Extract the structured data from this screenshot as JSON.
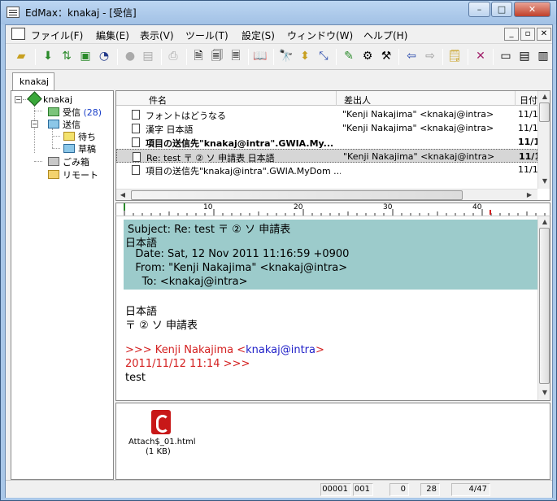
{
  "window": {
    "title": "EdMax：knakaj - [受信]",
    "min": "–",
    "max": "□",
    "close": "✕"
  },
  "menu": {
    "items": [
      "ファイル(F)",
      "編集(E)",
      "表示(V)",
      "ツール(T)",
      "設定(S)",
      "ウィンドウ(W)",
      "ヘルプ(H)"
    ],
    "mdi": [
      "_",
      "▫",
      "✕"
    ]
  },
  "tab": {
    "label": "knakaj"
  },
  "tree": {
    "root": "knakaj",
    "inbox": "受信",
    "inbox_count": "(28)",
    "sent": "送信",
    "waiting": "待ち",
    "draft": "草稿",
    "trash": "ごみ箱",
    "remote": "リモート"
  },
  "list": {
    "headers": {
      "subject": "件名",
      "from": "差出人",
      "date": "日付"
    },
    "rows": [
      {
        "subject": "フォントはどうなる",
        "from": "\"Kenji Nakajima\" <knakaj@intra>",
        "date": "11/1"
      },
      {
        "subject": "漢字 日本語",
        "from": "\"Kenji Nakajima\" <knakaj@intra>",
        "date": "11/1"
      },
      {
        "subject": "項目の送信先\"knakaj@intra\".GWIA.My...",
        "from": "",
        "date": "11/1"
      },
      {
        "subject": "Re: test 〒 ② ソ 申請表 日本語",
        "from": "\"Kenji Nakajima\" <knakaj@intra>",
        "date": "11/1"
      },
      {
        "subject": "項目の送信先\"knakaj@intra\".GWIA.MyDom ...",
        "from": "",
        "date": "11/1"
      }
    ]
  },
  "ruler": {
    "labels": [
      "10",
      "20",
      "30",
      "40"
    ]
  },
  "message": {
    "hdr_subject": "Subject: Re: test 〒 ② ソ 申請表",
    "hdr_subject2": "日本語",
    "hdr_date": "   Date: Sat, 12 Nov 2011 11:16:59 +0900",
    "hdr_from": "   From: \"Kenji Nakajima\" <knakaj@intra>",
    "hdr_to": "     To: <knakaj@intra>",
    "body1": "日本語",
    "body2": "〒 ② ソ 申請表",
    "quote_prefix": ">>> Kenji Nakajima <",
    "quote_email": "knakaj@intra",
    "quote_suffix": ">",
    "quote_date": "2011/11/12 11:14 >>>",
    "body3": "test"
  },
  "attachment": {
    "name": "Attach$_01.html",
    "size": "(1 KB)"
  },
  "status": {
    "a": "00001",
    "b": "001",
    "c": "0",
    "d": "28",
    "e": "4/47"
  },
  "colors": {
    "header_bg": "#9ccbcb",
    "quote": "#d42020",
    "link": "#2020c8",
    "count": "#1a3fc8"
  }
}
